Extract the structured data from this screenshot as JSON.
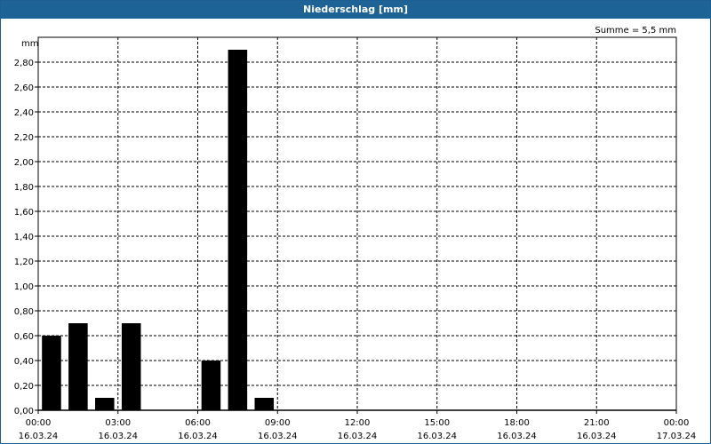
{
  "window": {
    "title": "Niederschlag [mm]"
  },
  "chart_data": {
    "type": "bar",
    "title": "Niederschlag [mm]",
    "ylabel": "mm",
    "annotation": "Summe = 5,5 mm",
    "ylim": [
      0,
      3.0
    ],
    "y_ticks": [
      "0,00",
      "0,20",
      "0,40",
      "0,60",
      "0,80",
      "1,00",
      "1,20",
      "1,40",
      "1,60",
      "1,80",
      "2,00",
      "2,20",
      "2,40",
      "2,60",
      "2,80"
    ],
    "x_ticks": [
      {
        "time": "00:00",
        "date": "16.03.24"
      },
      {
        "time": "03:00",
        "date": "16.03.24"
      },
      {
        "time": "06:00",
        "date": "16.03.24"
      },
      {
        "time": "09:00",
        "date": "16.03.24"
      },
      {
        "time": "12:00",
        "date": "16.03.24"
      },
      {
        "time": "15:00",
        "date": "16.03.24"
      },
      {
        "time": "18:00",
        "date": "16.03.24"
      },
      {
        "time": "21:00",
        "date": "16.03.24"
      },
      {
        "time": "00:00",
        "date": "17.03.24"
      }
    ],
    "categories": [
      "00:00",
      "01:00",
      "02:00",
      "03:00",
      "04:00",
      "05:00",
      "06:00",
      "07:00",
      "08:00"
    ],
    "values": [
      0.6,
      0.7,
      0.1,
      0.7,
      0.0,
      0.0,
      0.4,
      2.9,
      0.1
    ],
    "grid": true,
    "bar_color": "#000000"
  }
}
